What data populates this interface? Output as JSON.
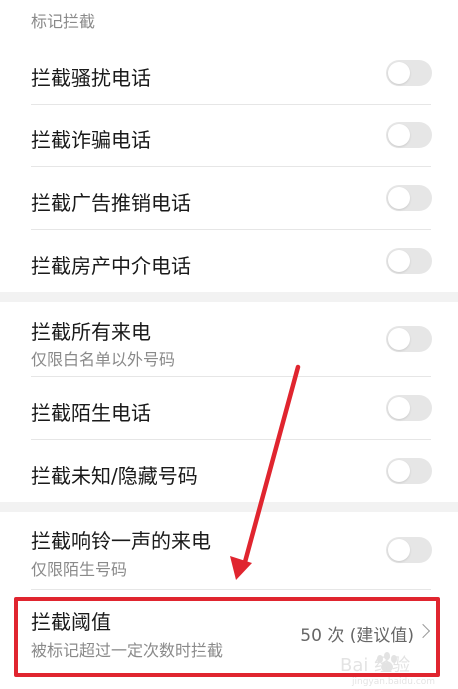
{
  "section": {
    "header": "标记拦截"
  },
  "rows": [
    {
      "title": "拦截骚扰电话"
    },
    {
      "title": "拦截诈骗电话"
    },
    {
      "title": "拦截广告推销电话"
    },
    {
      "title": "拦截房产中介电话"
    },
    {
      "title": "拦截所有来电",
      "subtitle": "仅限白名单以外号码"
    },
    {
      "title": "拦截陌生电话"
    },
    {
      "title": "拦截未知/隐藏号码"
    },
    {
      "title": "拦截响铃一声的来电",
      "subtitle": "仅限陌生号码"
    }
  ],
  "threshold": {
    "title": "拦截阈值",
    "subtitle": "被标记超过一定次数时拦截",
    "value": "50 次 (建议值)"
  },
  "annotation": {
    "color": "#e0252f"
  },
  "watermark": {
    "text": "Bai 经验",
    "subtext": "jingyan.baidu.com"
  },
  "colors": {
    "toggle_off": "#e6e6e6",
    "text_primary": "#1a1a1a",
    "text_secondary": "#8a8a8a"
  }
}
